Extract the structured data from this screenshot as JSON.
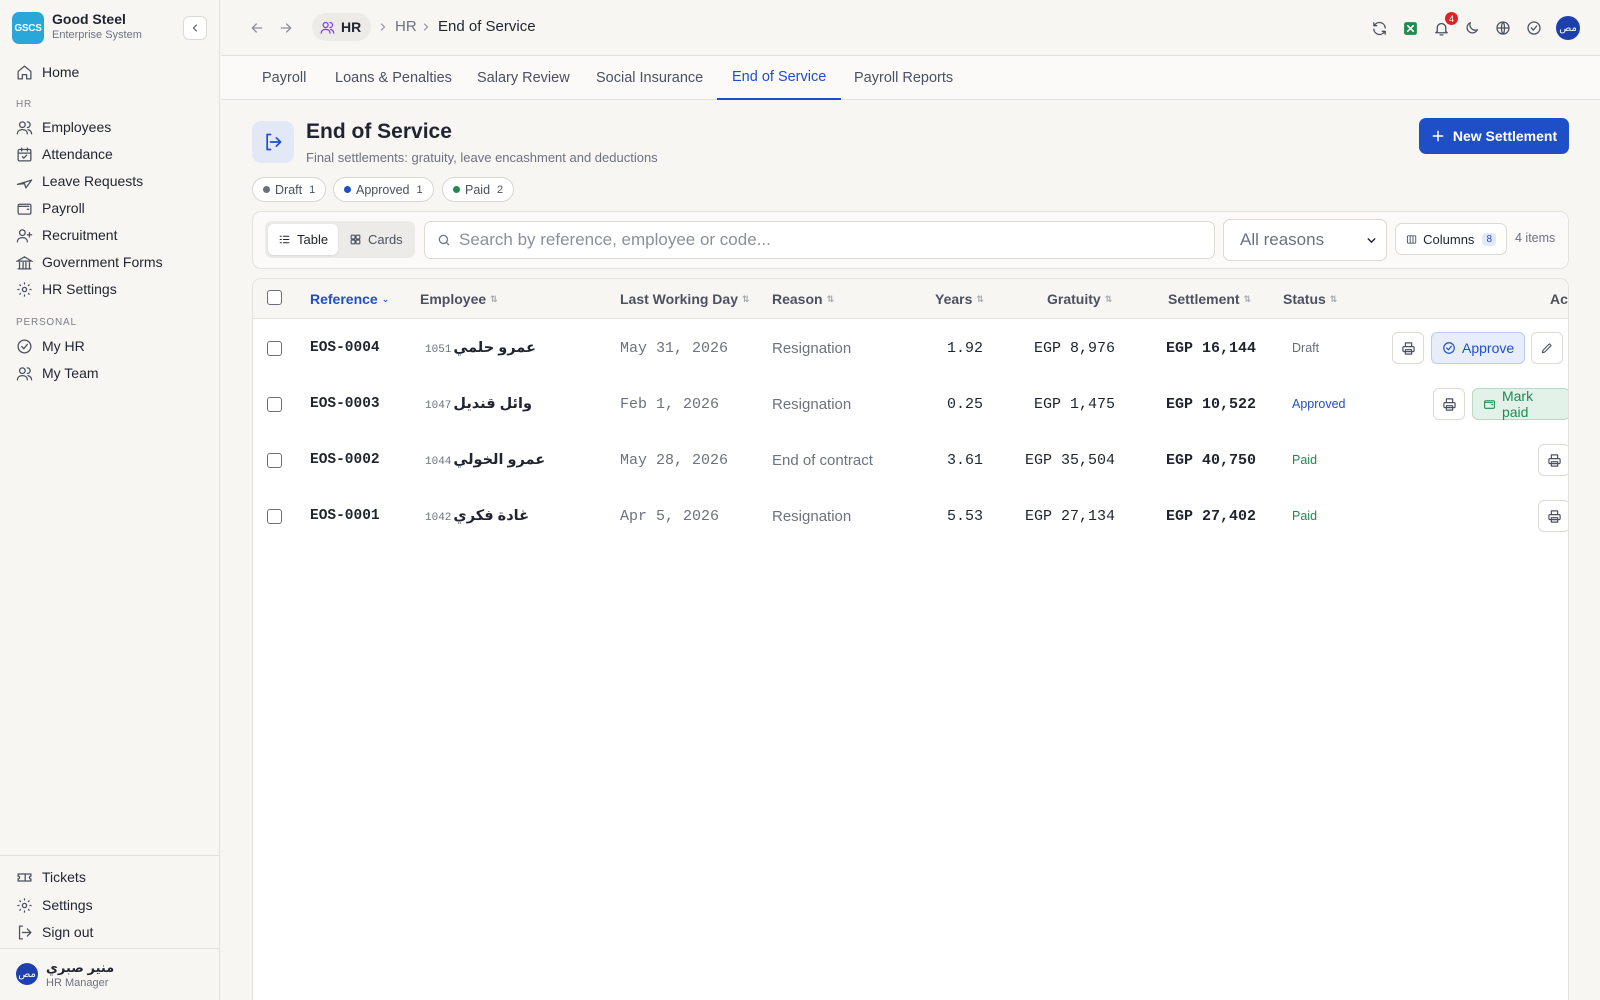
{
  "brand": {
    "logo_text": "GSCS",
    "name": "Good Steel",
    "subtitle": "Enterprise System"
  },
  "sidebar": {
    "home": "Home",
    "hr_section": "HR",
    "hr_items": [
      "Employees",
      "Attendance",
      "Leave Requests",
      "Payroll",
      "Recruitment",
      "Government Forms",
      "HR Settings"
    ],
    "personal_section": "PERSONAL",
    "personal_items": [
      "My HR",
      "My Team"
    ],
    "bottom_items": [
      "Tickets",
      "Settings",
      "Sign out"
    ]
  },
  "user": {
    "initials": "مص",
    "name": "منير صبري",
    "role": "HR Manager"
  },
  "breadcrumb": {
    "module": "HR",
    "section": "HR",
    "page": "End of Service"
  },
  "header": {
    "notification_count": "4"
  },
  "tabs": [
    "Payroll",
    "Loans & Penalties",
    "Salary Review",
    "Social Insurance",
    "End of Service",
    "Payroll Reports"
  ],
  "active_tab": "End of Service",
  "page": {
    "title": "End of Service",
    "subtitle": "Final settlements: gratuity, leave encashment and deductions",
    "new_button": "New Settlement"
  },
  "status_filters": [
    {
      "label": "Draft",
      "count": "1",
      "color": "#6b6f78"
    },
    {
      "label": "Approved",
      "count": "1",
      "color": "#1e4fc7"
    },
    {
      "label": "Paid",
      "count": "2",
      "color": "#1f8a52"
    }
  ],
  "toolbar": {
    "view_table": "Table",
    "view_cards": "Cards",
    "search_placeholder": "Search by reference, employee or code...",
    "reason_filter": "All reasons",
    "columns_label": "Columns",
    "columns_count": "8",
    "items_count": "4 items"
  },
  "table": {
    "columns": [
      "Reference",
      "Employee",
      "Last Working Day",
      "Reason",
      "Years",
      "Gratuity",
      "Settlement",
      "Status",
      "Ac"
    ],
    "rows": [
      {
        "reference": "EOS-0004",
        "employee_code": "1051",
        "employee_name": "عمرو حلمي",
        "last_day": "May 31, 2026",
        "reason": "Resignation",
        "years": "1.92",
        "gratuity": "EGP 8,976",
        "settlement": "EGP 16,144",
        "status": "Draft"
      },
      {
        "reference": "EOS-0003",
        "employee_code": "1047",
        "employee_name": "وائل قنديل",
        "last_day": "Feb 1, 2026",
        "reason": "Resignation",
        "years": "0.25",
        "gratuity": "EGP 1,475",
        "settlement": "EGP 10,522",
        "status": "Approved"
      },
      {
        "reference": "EOS-0002",
        "employee_code": "1044",
        "employee_name": "عمرو الخولي",
        "last_day": "May 28, 2026",
        "reason": "End of contract",
        "years": "3.61",
        "gratuity": "EGP 35,504",
        "settlement": "EGP 40,750",
        "status": "Paid"
      },
      {
        "reference": "EOS-0001",
        "employee_code": "1042",
        "employee_name": "غادة فكري",
        "last_day": "Apr 5, 2026",
        "reason": "Resignation",
        "years": "5.53",
        "gratuity": "EGP 27,134",
        "settlement": "EGP 27,402",
        "status": "Paid"
      }
    ],
    "actions": {
      "approve": "Approve",
      "mark_paid": "Mark paid"
    }
  },
  "colors": {
    "accent": "#1e4fc7",
    "draft": "#6b6f78",
    "approved": "#1e4fc7",
    "paid": "#1f8a52"
  }
}
